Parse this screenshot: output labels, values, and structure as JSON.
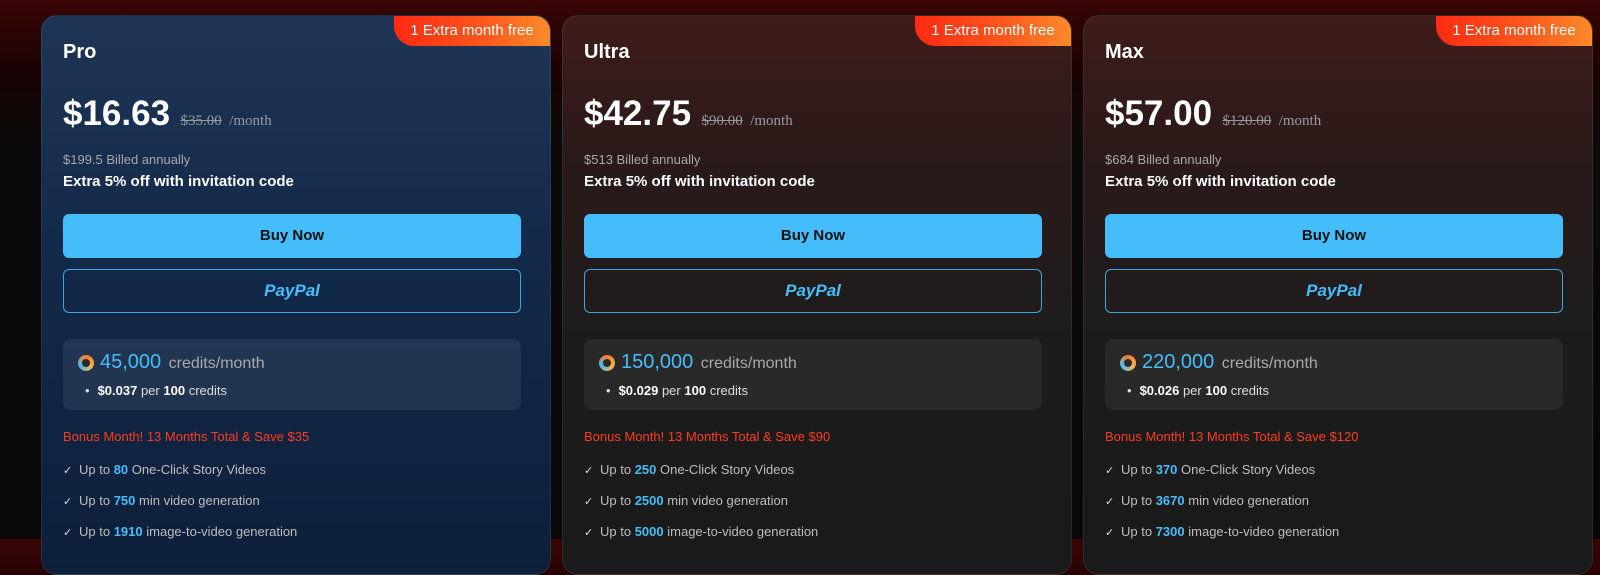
{
  "plans": [
    {
      "name": "Pro",
      "ribbon": "1 Extra month free",
      "price": "$16.63",
      "old_price": "$35.00",
      "per": "/month",
      "billed": "$199.5 Billed annually",
      "extra": "Extra 5% off with invitation code",
      "buy_label": "Buy Now",
      "paypal_label": "PayPal",
      "credits_amount": "45,000",
      "credits_unit": "credits/month",
      "rate_price": "$0.037",
      "rate_per": "per",
      "rate_qty": "100",
      "rate_unit": "credits",
      "bonus": "Bonus Month! 13 Months Total & Save $35",
      "features": [
        {
          "pre": "Up to",
          "num": "80",
          "post": "One-Click Story Videos"
        },
        {
          "pre": "Up to",
          "num": "750",
          "post": "min video generation"
        },
        {
          "pre": "Up to",
          "num": "1910",
          "post": "image-to-video generation"
        }
      ]
    },
    {
      "name": "Ultra",
      "ribbon": "1 Extra month free",
      "price": "$42.75",
      "old_price": "$90.00",
      "per": "/month",
      "billed": "$513 Billed annually",
      "extra": "Extra 5% off with invitation code",
      "buy_label": "Buy Now",
      "paypal_label": "PayPal",
      "credits_amount": "150,000",
      "credits_unit": "credits/month",
      "rate_price": "$0.029",
      "rate_per": "per",
      "rate_qty": "100",
      "rate_unit": "credits",
      "bonus": "Bonus Month! 13 Months Total & Save $90",
      "features": [
        {
          "pre": "Up to",
          "num": "250",
          "post": "One-Click Story Videos"
        },
        {
          "pre": "Up to",
          "num": "2500",
          "post": "min video generation"
        },
        {
          "pre": "Up to",
          "num": "5000",
          "post": "image-to-video generation"
        }
      ]
    },
    {
      "name": "Max",
      "ribbon": "1 Extra month free",
      "price": "$57.00",
      "old_price": "$120.00",
      "per": "/month",
      "billed": "$684 Billed annually",
      "extra": "Extra 5% off with invitation code",
      "buy_label": "Buy Now",
      "paypal_label": "PayPal",
      "credits_amount": "220,000",
      "credits_unit": "credits/month",
      "rate_price": "$0.026",
      "rate_per": "per",
      "rate_qty": "100",
      "rate_unit": "credits",
      "bonus": "Bonus Month! 13 Months Total & Save $120",
      "features": [
        {
          "pre": "Up to",
          "num": "370",
          "post": "One-Click Story Videos"
        },
        {
          "pre": "Up to",
          "num": "3670",
          "post": "min video generation"
        },
        {
          "pre": "Up to",
          "num": "7300",
          "post": "image-to-video generation"
        }
      ]
    }
  ],
  "colors": {
    "accent": "#45bdfb",
    "bonus": "#ff3b1f",
    "ribbon": "#ff4a1a"
  },
  "icons": {
    "coin": "credits-coin-icon",
    "check": "check-icon"
  }
}
